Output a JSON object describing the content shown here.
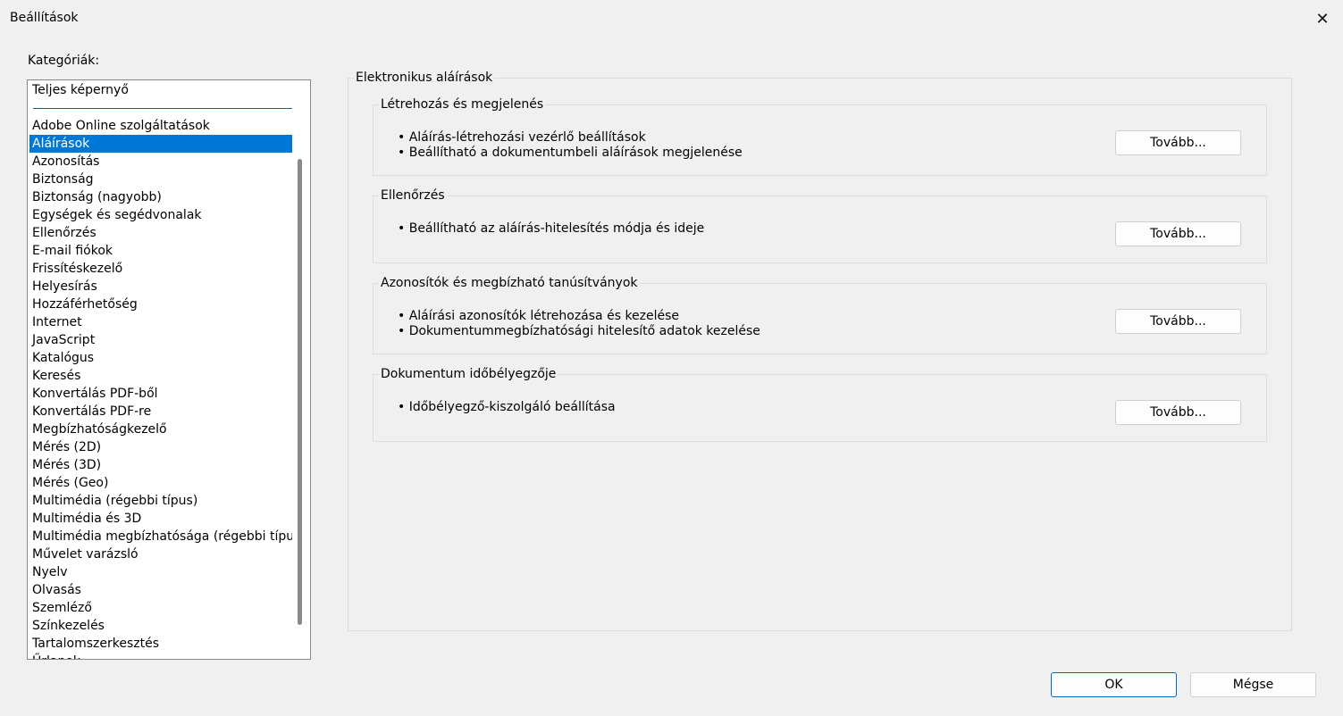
{
  "window": {
    "title": "Beállítások",
    "close_icon": "close-icon"
  },
  "categories": {
    "label": "Kategóriák:",
    "items_top": [
      "Teljes képernyő"
    ],
    "items": [
      "Adobe Online szolgáltatások",
      "Aláírások",
      "Azonosítás",
      "Biztonság",
      "Biztonság (nagyobb)",
      "Egységek és segédvonalak",
      "Ellenőrzés",
      "E-mail fiókok",
      "Frissítéskezelő",
      "Helyesírás",
      "Hozzáférhetőség",
      "Internet",
      "JavaScript",
      "Katalógus",
      "Keresés",
      "Konvertálás PDF-ből",
      "Konvertálás PDF-re",
      "Megbízhatóságkezelő",
      "Mérés (2D)",
      "Mérés (3D)",
      "Mérés (Geo)",
      "Multimédia (régebbi típus)",
      "Multimédia és 3D",
      "Multimédia megbízhatósága (régebbi típus)",
      "Művelet varázsló",
      "Nyelv",
      "Olvasás",
      "Szemléző",
      "Színkezelés",
      "Tartalomszerkesztés",
      "Űrlapok"
    ],
    "selected": "Aláírások"
  },
  "main": {
    "title": "Elektronikus aláírások",
    "sections": [
      {
        "title": "Létrehozás és megjelenés",
        "bullets": [
          "• Aláírás-létrehozási vezérlő beállítások",
          "• Beállítható a dokumentumbeli aláírások megjelenése"
        ],
        "button": "Tovább..."
      },
      {
        "title": "Ellenőrzés",
        "bullets": [
          "• Beállítható az aláírás-hitelesítés módja és ideje"
        ],
        "button": "Tovább..."
      },
      {
        "title": "Azonosítók és megbízható tanúsítványok",
        "bullets": [
          "• Aláírási azonosítók létrehozása és kezelése",
          "• Dokumentummegbízhatósági hitelesítő adatok kezelése"
        ],
        "button": "Tovább..."
      },
      {
        "title": "Dokumentum időbélyegzője",
        "bullets": [
          "• Időbélyegző-kiszolgáló beállítása"
        ],
        "button": "Tovább..."
      }
    ]
  },
  "footer": {
    "ok": "OK",
    "cancel": "Mégse"
  },
  "colors": {
    "selection": "#0078d7",
    "ok_border": "#0067c0"
  }
}
